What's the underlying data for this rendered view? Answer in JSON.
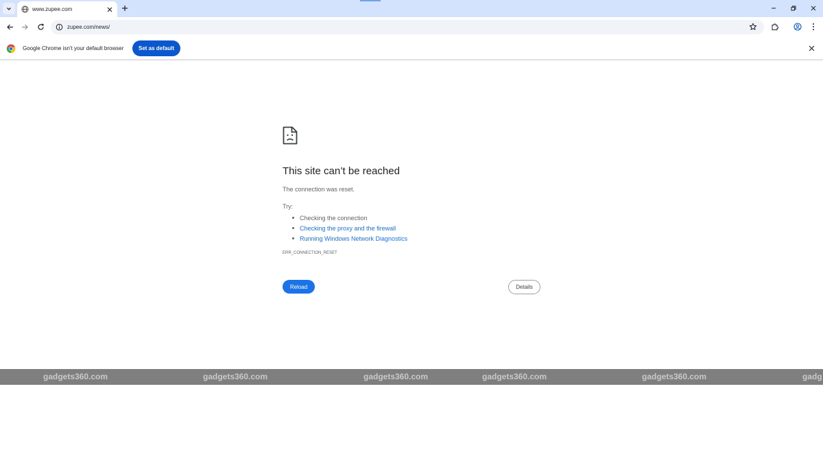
{
  "browser": {
    "tab": {
      "title": "www.zupee.com",
      "favicon": "globe-icon"
    },
    "address": {
      "url": "zupee.com/news/"
    },
    "infobar": {
      "message": "Google Chrome isn't your default browser",
      "button_label": "Set as default"
    }
  },
  "error_page": {
    "icon": "sad-page-icon",
    "title": "This site can’t be reached",
    "subtitle": "The connection was reset.",
    "try_label": "Try:",
    "suggestions": [
      "Checking the connection",
      "Checking the proxy and the firewall",
      "Running Windows Network Diagnostics"
    ],
    "error_code": "ERR_CONNECTION_RESET",
    "reload_label": "Reload",
    "details_label": "Details"
  },
  "watermark": {
    "text": "gadgets360.com",
    "partial_text": "gadg"
  },
  "colors": {
    "tabstrip_bg": "#d3e3fd",
    "omnibox_bg": "#f0f4f9",
    "primary_button": "#0b57d0",
    "link": "#1a73e8",
    "watermark_band": "#7f7f7f"
  }
}
